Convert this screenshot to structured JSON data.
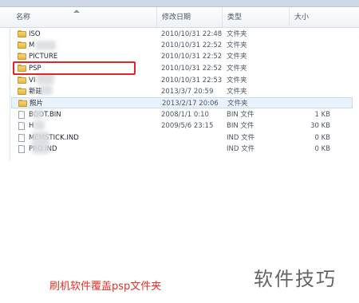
{
  "columns": {
    "name": "名称",
    "date": "修改日期",
    "type": "类型",
    "size": "大小"
  },
  "rows": [
    {
      "icon": "folder-icon",
      "name": "ISO",
      "date": "2010/10/31 22:48",
      "type": "文件夹",
      "size": ""
    },
    {
      "icon": "folder-icon",
      "name": "M",
      "date": "2010/10/31 22:52",
      "type": "文件夹",
      "size": ""
    },
    {
      "icon": "folder-icon",
      "name": "PICTURE",
      "date": "2010/10/31 22:52",
      "type": "文件夹",
      "size": ""
    },
    {
      "icon": "folder-icon",
      "name": "PSP",
      "date": "2010/10/31 22:52",
      "type": "文件夹",
      "size": ""
    },
    {
      "icon": "folder-icon",
      "name": "VI",
      "date": "2010/10/31 22:53",
      "type": "文件夹",
      "size": ""
    },
    {
      "icon": "folder-icon",
      "name": "新建",
      "date": "2013/3/7 20:59",
      "type": "文件夹",
      "size": ""
    },
    {
      "icon": "folder-icon",
      "name": "照片",
      "date": "2013/2/17 20:06",
      "type": "文件夹",
      "size": ""
    },
    {
      "icon": "file-icon",
      "name": "BOOT.BIN",
      "date": "2008/1/1 0:10",
      "type": "BIN 文件",
      "size": "1 KB"
    },
    {
      "icon": "file-icon",
      "name": "H",
      "date": "2009/5/6 23:15",
      "type": "BIN 文件",
      "size": "30 KB"
    },
    {
      "icon": "file-icon",
      "name": "MEMSTICK.IND",
      "date": "",
      "type": "IND 文件",
      "size": "0 KB"
    },
    {
      "icon": "file-icon",
      "name": "PRO.IND",
      "date": "",
      "type": "IND 文件",
      "size": "0 KB"
    }
  ],
  "caption": "刷机软件覆盖psp文件夹",
  "watermark": "软件技巧",
  "colors": {
    "highlight": "#e0262b",
    "caption": "#e5312b",
    "selection": "#eaf3fc"
  }
}
